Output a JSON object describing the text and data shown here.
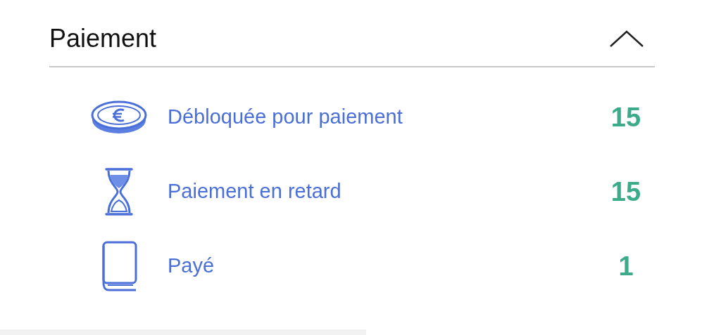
{
  "section": {
    "title": "Paiement",
    "expanded": true
  },
  "items": [
    {
      "kind": "coin",
      "label": "Débloquée pour paiement",
      "count": "15"
    },
    {
      "kind": "hourglass",
      "label": "Paiement en retard",
      "count": "15"
    },
    {
      "kind": "book",
      "label": "Payé",
      "count": "1"
    }
  ]
}
